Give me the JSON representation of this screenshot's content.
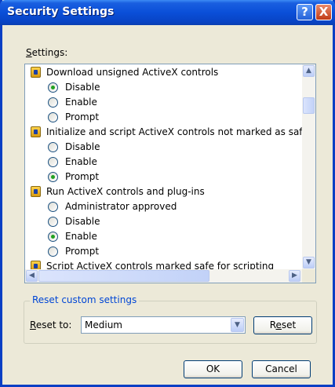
{
  "window": {
    "title": "Security Settings",
    "help_glyph": "?",
    "close_glyph": "X"
  },
  "settings_label": "ettings:",
  "settings_label_accel": "S",
  "list": [
    {
      "type": "category",
      "text": "Download unsigned ActiveX controls"
    },
    {
      "type": "option",
      "text": "Disable",
      "checked": true
    },
    {
      "type": "option",
      "text": "Enable",
      "checked": false
    },
    {
      "type": "option",
      "text": "Prompt",
      "checked": false
    },
    {
      "type": "category",
      "text": "Initialize and script ActiveX controls not marked as safe"
    },
    {
      "type": "option",
      "text": "Disable",
      "checked": false
    },
    {
      "type": "option",
      "text": "Enable",
      "checked": false
    },
    {
      "type": "option",
      "text": "Prompt",
      "checked": true
    },
    {
      "type": "category",
      "text": "Run ActiveX controls and plug-ins"
    },
    {
      "type": "option",
      "text": "Administrator approved",
      "checked": false
    },
    {
      "type": "option",
      "text": "Disable",
      "checked": false
    },
    {
      "type": "option",
      "text": "Enable",
      "checked": true
    },
    {
      "type": "option",
      "text": "Prompt",
      "checked": false
    },
    {
      "type": "category",
      "text": "Script ActiveX controls marked safe for scripting"
    }
  ],
  "scroll_glyphs": {
    "up": "▲",
    "down": "▼",
    "left": "◀",
    "right": "▶"
  },
  "reset_group": {
    "title": "Reset custom settings",
    "reset_to_accel": "R",
    "reset_to_label": "eset to:",
    "selected": "Medium",
    "dropdown_glyph": "▼",
    "reset_button_pre": "R",
    "reset_button_accel": "e",
    "reset_button_post": "set"
  },
  "buttons": {
    "ok": "OK",
    "cancel": "Cancel"
  }
}
